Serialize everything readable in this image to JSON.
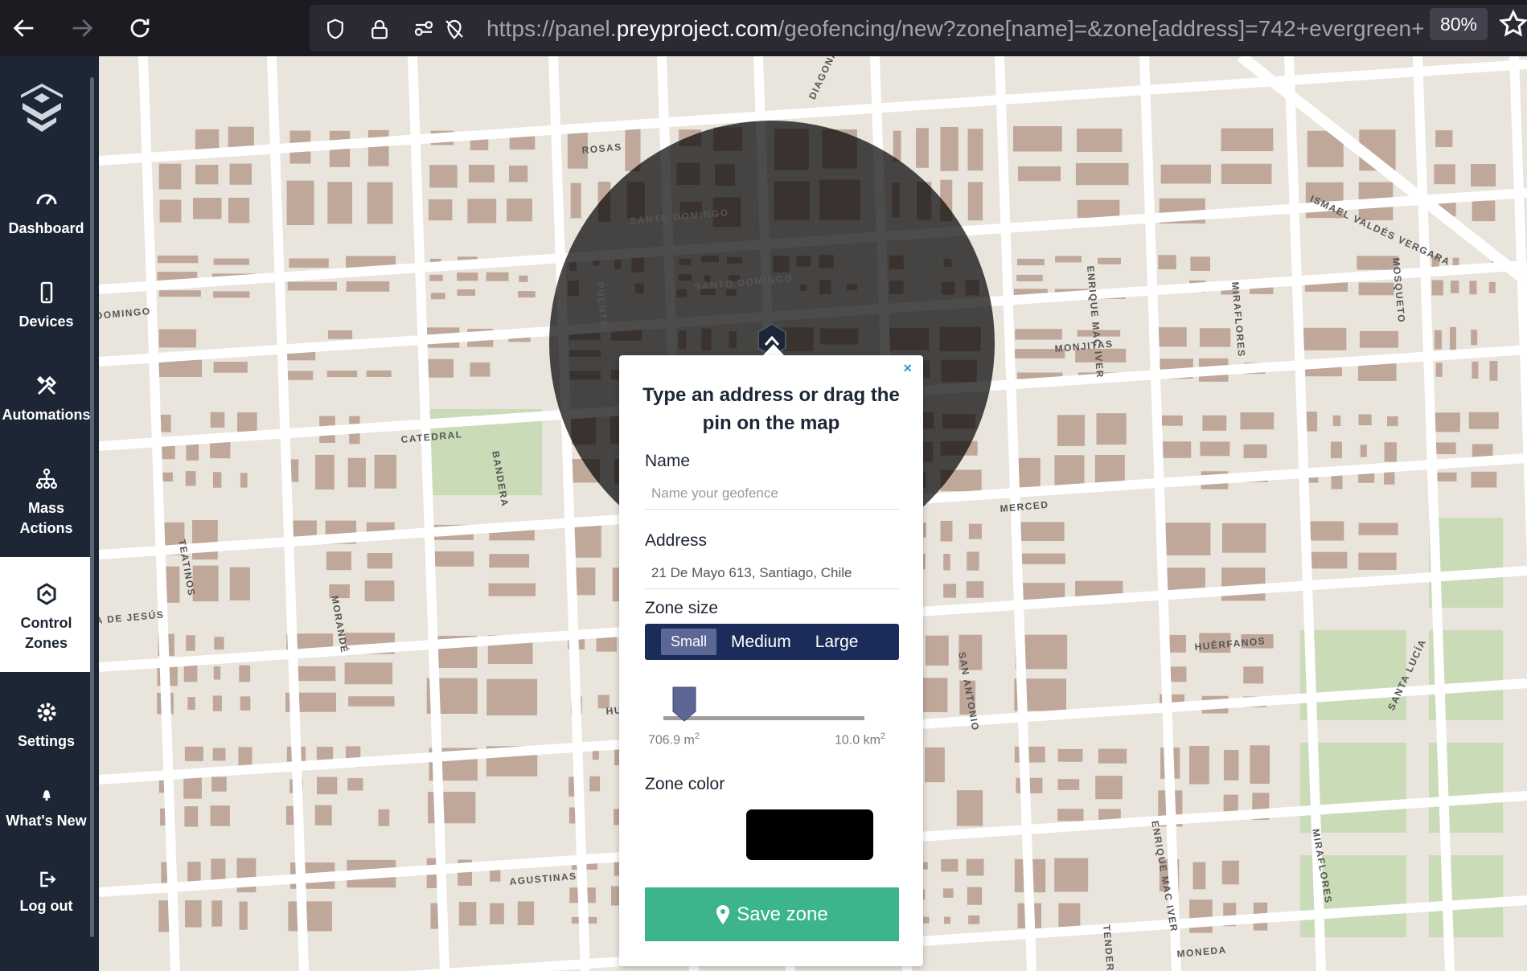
{
  "browser": {
    "url_prefix": "https://panel.",
    "url_domain": "preyproject.com",
    "url_suffix": "/geofencing/new?zone[name]=&zone[address]=742+evergreen+",
    "zoom": "80%"
  },
  "sidebar": {
    "items": [
      {
        "label": "Dashboard",
        "icon": "speedometer-icon"
      },
      {
        "label": "Devices",
        "icon": "mobile-device-icon"
      },
      {
        "label": "Automations",
        "icon": "tools-icon"
      },
      {
        "label": "Mass Actions",
        "icon": "hierarchy-icon"
      },
      {
        "label": "Control Zones",
        "icon": "control-zones-icon"
      },
      {
        "label": "Settings",
        "icon": "gear-icon"
      },
      {
        "label": "What's New",
        "icon": "bell-icon"
      },
      {
        "label": "Log out",
        "icon": "logout-icon"
      }
    ],
    "active": "Control Zones"
  },
  "map": {
    "street_labels": [
      "ROSAS",
      "DIAGONAL C",
      "SANTO DOMINGO",
      "PUENTE",
      "SANTO DOMINGO",
      "ISMAEL VALDÉS VERGARA",
      "ENRIQUE MAC IVER",
      "MIRAFLORES",
      "MOSQUETO",
      "DOMINGO",
      "MONJITAS",
      "CATEDRAL",
      "BANDERA",
      "MERCED",
      "TEATINOS",
      "MORANDÉ",
      "SAN ANTONIO",
      "A DE JESÚS",
      "HUÉRFANOS",
      "HU",
      "SANTA LUCÍA",
      "ENRIQUE MAC IVER",
      "MIRAFLORES",
      "AGUSTINAS",
      "TENDERINI",
      "MONEDA"
    ],
    "zone_color": "#000000"
  },
  "modal": {
    "close": "×",
    "title": "Type an address or drag the pin on the map",
    "name_label": "Name",
    "name_placeholder": "Name your geofence",
    "name_value": "",
    "address_label": "Address",
    "address_value": "21 De Mayo 613, Santiago, Chile",
    "zone_size_label": "Zone size",
    "zone_sizes": [
      "Small",
      "Medium",
      "Large"
    ],
    "zone_size_selected": "Small",
    "slider_min": "706.9 m",
    "slider_min_unit": "2",
    "slider_max": "10.0 km",
    "slider_max_unit": "2",
    "slider_value_fraction": 0.0,
    "zone_color_label": "Zone color",
    "zone_color": "#000000",
    "save_label": "Save zone"
  },
  "colors": {
    "sidebar_bg": "#1c2634",
    "save_button": "#3cb58a",
    "zone_size_bg": "#1c2c5a",
    "building": "#bfa799",
    "park": "#c9dbb7"
  }
}
